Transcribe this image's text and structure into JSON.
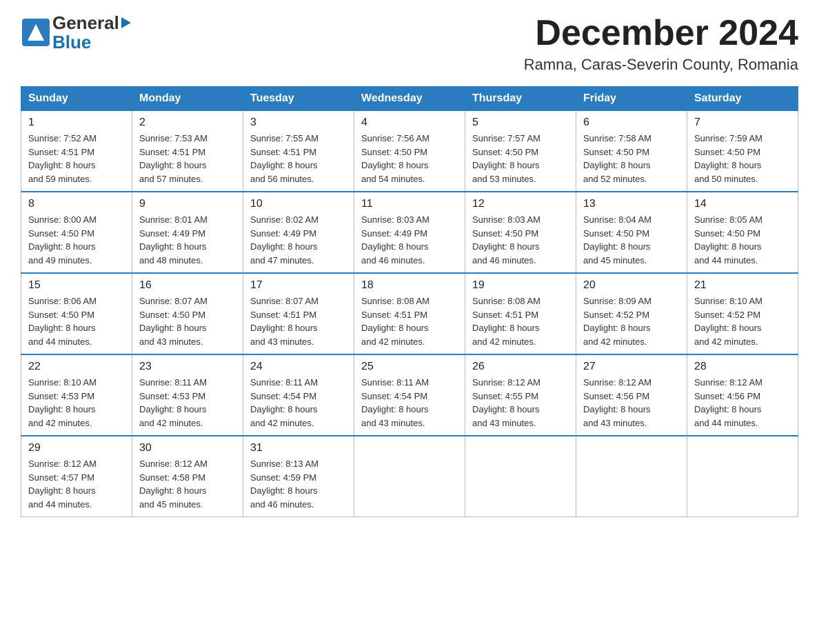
{
  "header": {
    "logo_general": "General",
    "logo_blue": "Blue",
    "month_title": "December 2024",
    "location": "Ramna, Caras-Severin County, Romania"
  },
  "days_of_week": [
    "Sunday",
    "Monday",
    "Tuesday",
    "Wednesday",
    "Thursday",
    "Friday",
    "Saturday"
  ],
  "weeks": [
    [
      {
        "day": "1",
        "sunrise": "7:52 AM",
        "sunset": "4:51 PM",
        "daylight": "8 hours and 59 minutes."
      },
      {
        "day": "2",
        "sunrise": "7:53 AM",
        "sunset": "4:51 PM",
        "daylight": "8 hours and 57 minutes."
      },
      {
        "day": "3",
        "sunrise": "7:55 AM",
        "sunset": "4:51 PM",
        "daylight": "8 hours and 56 minutes."
      },
      {
        "day": "4",
        "sunrise": "7:56 AM",
        "sunset": "4:50 PM",
        "daylight": "8 hours and 54 minutes."
      },
      {
        "day": "5",
        "sunrise": "7:57 AM",
        "sunset": "4:50 PM",
        "daylight": "8 hours and 53 minutes."
      },
      {
        "day": "6",
        "sunrise": "7:58 AM",
        "sunset": "4:50 PM",
        "daylight": "8 hours and 52 minutes."
      },
      {
        "day": "7",
        "sunrise": "7:59 AM",
        "sunset": "4:50 PM",
        "daylight": "8 hours and 50 minutes."
      }
    ],
    [
      {
        "day": "8",
        "sunrise": "8:00 AM",
        "sunset": "4:50 PM",
        "daylight": "8 hours and 49 minutes."
      },
      {
        "day": "9",
        "sunrise": "8:01 AM",
        "sunset": "4:49 PM",
        "daylight": "8 hours and 48 minutes."
      },
      {
        "day": "10",
        "sunrise": "8:02 AM",
        "sunset": "4:49 PM",
        "daylight": "8 hours and 47 minutes."
      },
      {
        "day": "11",
        "sunrise": "8:03 AM",
        "sunset": "4:49 PM",
        "daylight": "8 hours and 46 minutes."
      },
      {
        "day": "12",
        "sunrise": "8:03 AM",
        "sunset": "4:50 PM",
        "daylight": "8 hours and 46 minutes."
      },
      {
        "day": "13",
        "sunrise": "8:04 AM",
        "sunset": "4:50 PM",
        "daylight": "8 hours and 45 minutes."
      },
      {
        "day": "14",
        "sunrise": "8:05 AM",
        "sunset": "4:50 PM",
        "daylight": "8 hours and 44 minutes."
      }
    ],
    [
      {
        "day": "15",
        "sunrise": "8:06 AM",
        "sunset": "4:50 PM",
        "daylight": "8 hours and 44 minutes."
      },
      {
        "day": "16",
        "sunrise": "8:07 AM",
        "sunset": "4:50 PM",
        "daylight": "8 hours and 43 minutes."
      },
      {
        "day": "17",
        "sunrise": "8:07 AM",
        "sunset": "4:51 PM",
        "daylight": "8 hours and 43 minutes."
      },
      {
        "day": "18",
        "sunrise": "8:08 AM",
        "sunset": "4:51 PM",
        "daylight": "8 hours and 42 minutes."
      },
      {
        "day": "19",
        "sunrise": "8:08 AM",
        "sunset": "4:51 PM",
        "daylight": "8 hours and 42 minutes."
      },
      {
        "day": "20",
        "sunrise": "8:09 AM",
        "sunset": "4:52 PM",
        "daylight": "8 hours and 42 minutes."
      },
      {
        "day": "21",
        "sunrise": "8:10 AM",
        "sunset": "4:52 PM",
        "daylight": "8 hours and 42 minutes."
      }
    ],
    [
      {
        "day": "22",
        "sunrise": "8:10 AM",
        "sunset": "4:53 PM",
        "daylight": "8 hours and 42 minutes."
      },
      {
        "day": "23",
        "sunrise": "8:11 AM",
        "sunset": "4:53 PM",
        "daylight": "8 hours and 42 minutes."
      },
      {
        "day": "24",
        "sunrise": "8:11 AM",
        "sunset": "4:54 PM",
        "daylight": "8 hours and 42 minutes."
      },
      {
        "day": "25",
        "sunrise": "8:11 AM",
        "sunset": "4:54 PM",
        "daylight": "8 hours and 43 minutes."
      },
      {
        "day": "26",
        "sunrise": "8:12 AM",
        "sunset": "4:55 PM",
        "daylight": "8 hours and 43 minutes."
      },
      {
        "day": "27",
        "sunrise": "8:12 AM",
        "sunset": "4:56 PM",
        "daylight": "8 hours and 43 minutes."
      },
      {
        "day": "28",
        "sunrise": "8:12 AM",
        "sunset": "4:56 PM",
        "daylight": "8 hours and 44 minutes."
      }
    ],
    [
      {
        "day": "29",
        "sunrise": "8:12 AM",
        "sunset": "4:57 PM",
        "daylight": "8 hours and 44 minutes."
      },
      {
        "day": "30",
        "sunrise": "8:12 AM",
        "sunset": "4:58 PM",
        "daylight": "8 hours and 45 minutes."
      },
      {
        "day": "31",
        "sunrise": "8:13 AM",
        "sunset": "4:59 PM",
        "daylight": "8 hours and 46 minutes."
      },
      null,
      null,
      null,
      null
    ]
  ],
  "labels": {
    "sunrise": "Sunrise:",
    "sunset": "Sunset:",
    "daylight": "Daylight:"
  }
}
